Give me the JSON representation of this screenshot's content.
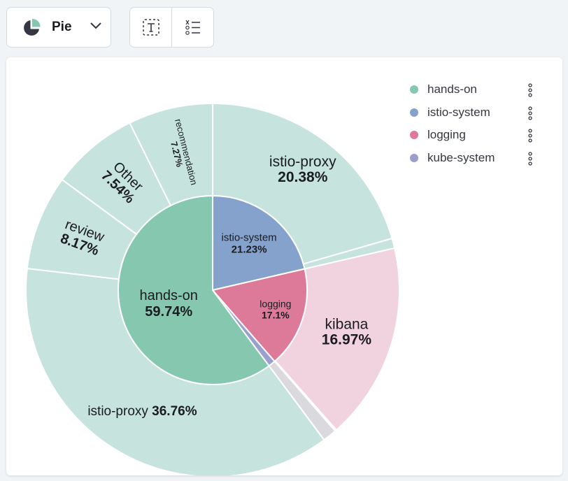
{
  "toolbar": {
    "chart_type_label": "Pie",
    "chart_type_icon": "pie-chart-icon",
    "text_button_icon": "text-format-icon",
    "legend_button_icon": "list-order-icon"
  },
  "colors": {
    "hands-on": "#86c7b0",
    "istio-system": "#84a2cc",
    "logging": "#dd7a99",
    "kube-system": "#9b9fcd",
    "hands-on-light": "#c6e3de",
    "logging-light": "#f1d3df",
    "other-light": "#dadade",
    "tick": "#5b5c68"
  },
  "legend": {
    "items": [
      {
        "name": "hands-on",
        "color": "#86c7b0"
      },
      {
        "name": "istio-system",
        "color": "#84a2cc"
      },
      {
        "name": "logging",
        "color": "#dd7a99"
      },
      {
        "name": "kube-system",
        "color": "#9b9fcd"
      }
    ],
    "more_icon": "vertical-dots-icon"
  },
  "chart_data": {
    "type": "pie",
    "subtype": "sunburst",
    "inner": [
      {
        "label": "hands-on",
        "percent_label": "59.74%",
        "value": 59.74,
        "color": "#86c7b0"
      },
      {
        "label": "istio-system",
        "percent_label": "21.23%",
        "value": 21.23,
        "color": "#84a2cc"
      },
      {
        "label": "logging",
        "percent_label": "17.1%",
        "value": 17.1,
        "color": "#dd7a99"
      },
      {
        "label": "kube-system",
        "value": 1.2,
        "color": "#9b9fcd"
      }
    ],
    "outer": [
      {
        "label": "istio-proxy",
        "percent_label": "20.38%",
        "value": 20.38,
        "parent": "istio-system",
        "color": "#c6e3de"
      },
      {
        "value": 0.85,
        "parent": "istio-system",
        "color": "#c6e3de"
      },
      {
        "label": "kibana",
        "percent_label": "16.97%",
        "value": 16.97,
        "parent": "logging",
        "color": "#f1d3df"
      },
      {
        "value": 0.13,
        "parent": "logging",
        "color": "#f1d3df"
      },
      {
        "value": 1.2,
        "parent": "kube-system",
        "color": "#dadade"
      },
      {
        "label": "istio-proxy",
        "percent_label": "36.76%",
        "value": 36.76,
        "parent": "hands-on",
        "color": "#c6e3de"
      },
      {
        "label": "review",
        "percent_label": "8.17%",
        "value": 8.17,
        "parent": "hands-on",
        "color": "#c6e3de"
      },
      {
        "label": "Other",
        "percent_label": "7.54%",
        "value": 7.54,
        "parent": "hands-on",
        "color": "#c6e3de"
      },
      {
        "label": "recommendation",
        "percent_label": "7.27%",
        "value": 7.27,
        "parent": "hands-on",
        "color": "#c6e3de"
      }
    ],
    "legend_position": "top-right"
  }
}
